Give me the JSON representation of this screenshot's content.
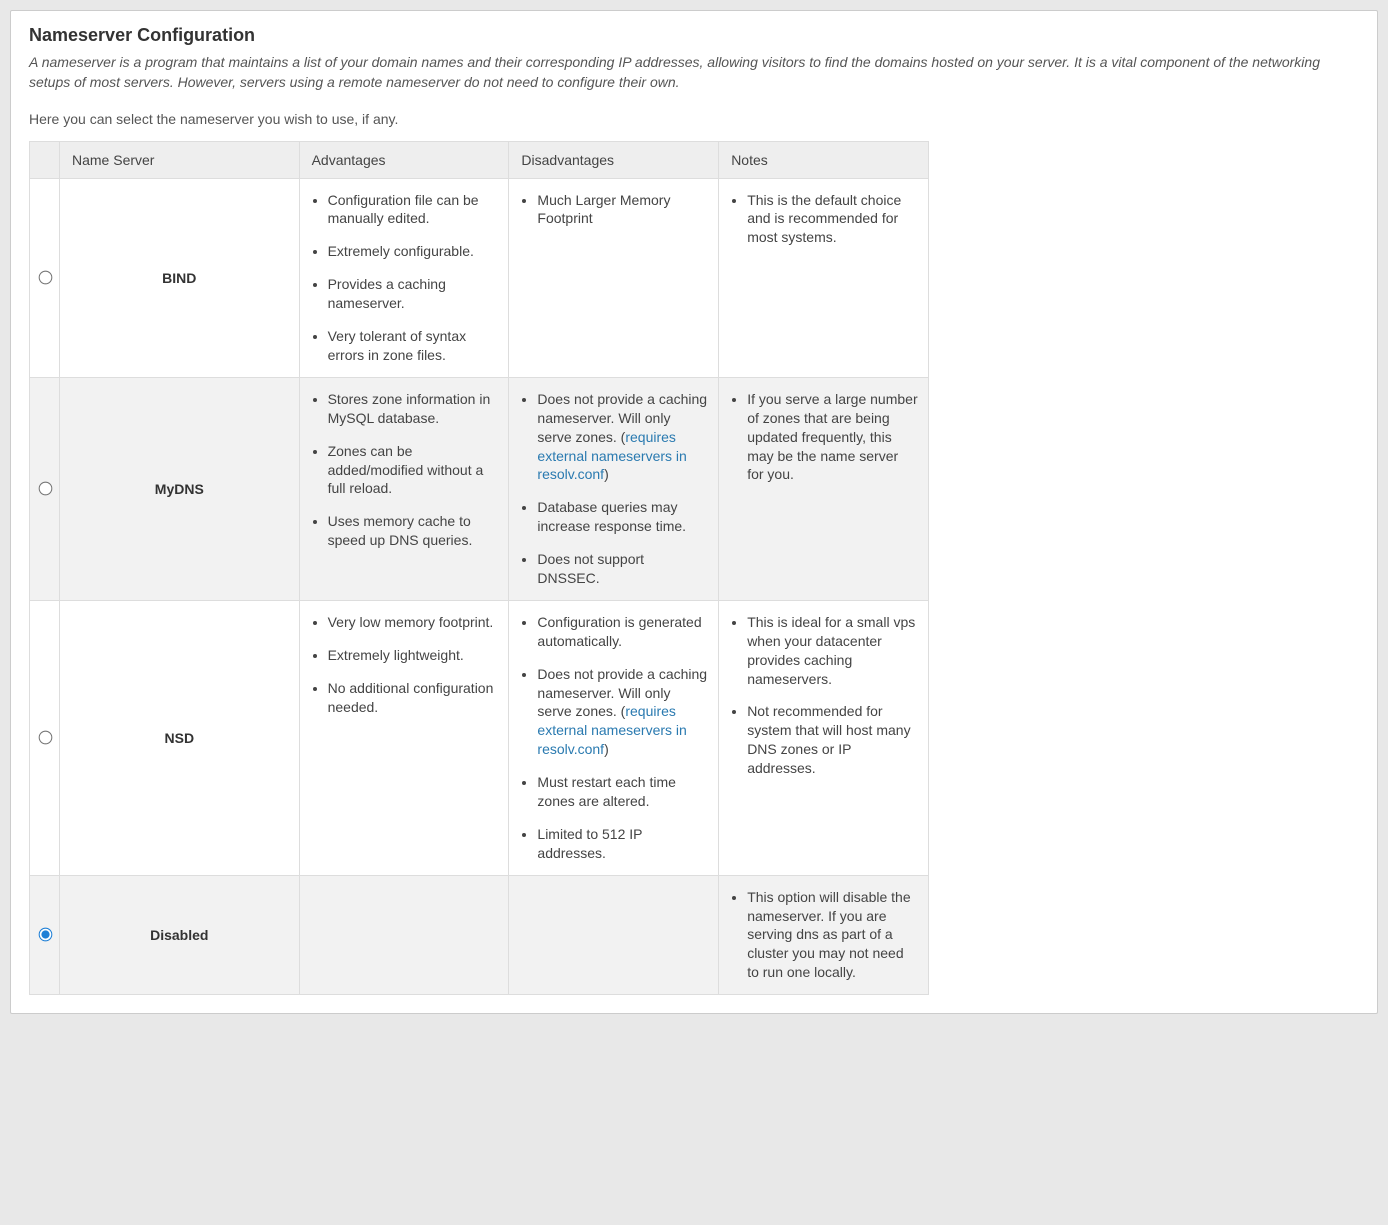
{
  "page": {
    "title": "Nameserver Configuration",
    "intro_italic": "A nameserver is a program that maintains a list of your domain names and their corresponding IP addresses, allowing visitors to find the domains hosted on your server. It is a vital component of the networking setups of most servers. However, servers using a remote nameserver do not need to configure their own.",
    "intro_plain": "Here you can select the nameserver you wish to use, if any."
  },
  "table": {
    "headers": {
      "name": "Name Server",
      "advantages": "Advantages",
      "disadvantages": "Disadvantages",
      "notes": "Notes"
    }
  },
  "link_text": "requires external nameservers in resolv.conf",
  "rows": {
    "bind": {
      "name": "BIND",
      "adv": [
        "Configuration file can be manually edited.",
        "Extremely configurable.",
        "Provides a caching nameserver.",
        "Very tolerant of syntax errors in zone files."
      ],
      "dis_0": "Much Larger Memory Footprint",
      "notes_0": "This is the default choice and is recommended for most systems."
    },
    "mydns": {
      "name": "MyDNS",
      "adv": [
        "Stores zone information in MySQL database.",
        "Zones can be added/modified without a full reload.",
        "Uses memory cache to speed up DNS queries."
      ],
      "dis_0_pre": "Does not provide a caching nameserver. Will only serve zones. (",
      "dis_0_post": ")",
      "dis_1": "Database queries may increase response time.",
      "dis_2": "Does not support DNSSEC.",
      "notes_0": "If you serve a large number of zones that are being updated frequently, this may be the name server for you."
    },
    "nsd": {
      "name": "NSD",
      "adv": [
        "Very low memory footprint.",
        "Extremely lightweight.",
        "No additional configuration needed."
      ],
      "dis_0": "Configuration is generated automatically.",
      "dis_1_pre": "Does not provide a caching nameserver. Will only serve zones. (",
      "dis_1_post": ")",
      "dis_2": "Must restart each time zones are altered.",
      "dis_3": "Limited to 512 IP addresses.",
      "notes_0": "This is ideal for a small vps when your datacenter provides caching nameservers.",
      "notes_1": "Not recommended for system that will host many DNS zones or IP addresses."
    },
    "disabled": {
      "name": "Disabled",
      "notes_0": "This option will disable the nameserver. If you are serving dns as part of a cluster you may not need to run one locally."
    }
  }
}
